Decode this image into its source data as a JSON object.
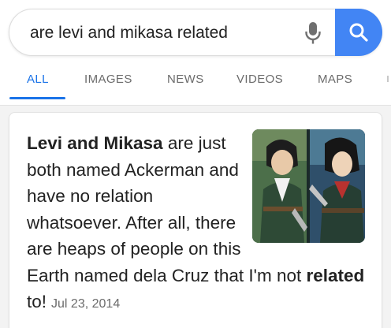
{
  "search": {
    "query": "are levi and mikasa related"
  },
  "tabs": [
    {
      "label": "ALL",
      "active": true
    },
    {
      "label": "IMAGES",
      "active": false
    },
    {
      "label": "NEWS",
      "active": false
    },
    {
      "label": "VIDEOS",
      "active": false
    },
    {
      "label": "MAPS",
      "active": false
    }
  ],
  "result": {
    "bold_lead": "Levi and Mikasa",
    "text_1": " are just both named Ackerman and have no relation whatsoever. After all, there are heaps of people on this Earth named dela Cruz that I'm not ",
    "bold_word": "related",
    "text_2": " to!",
    "date": "Jul 23, 2014"
  },
  "colors": {
    "accent": "#4285f4",
    "tab_active": "#1a73e8",
    "tab_inactive": "#6b6b6b",
    "background": "#f3f3f3"
  },
  "icons": {
    "mic": "microphone-icon",
    "search": "search-icon"
  }
}
